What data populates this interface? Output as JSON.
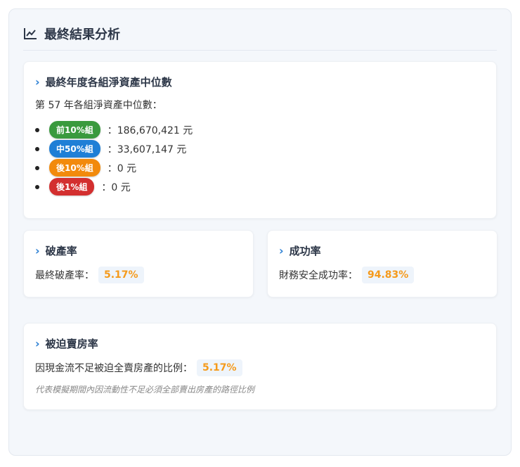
{
  "title": "最終結果分析",
  "median": {
    "heading": "最終年度各組淨資產中位數",
    "intro": "第 57 年各組淨資產中位數：",
    "groups": [
      {
        "label": "前10%組",
        "value": "：186,670,421 元",
        "color": "#3a9a3e"
      },
      {
        "label": "中50%組",
        "value": "：33,607,147 元",
        "color": "#1f7fd6"
      },
      {
        "label": "後10%組",
        "value": "：0 元",
        "color": "#f28a0c"
      },
      {
        "label": "後1%組",
        "value": "：0 元",
        "color": "#d32f2f"
      }
    ]
  },
  "bankruptcy": {
    "heading": "破產率",
    "label": "最終破產率：",
    "value": "5.17%"
  },
  "success": {
    "heading": "成功率",
    "label": "財務安全成功率：",
    "value": "94.83%"
  },
  "forced": {
    "heading": "被迫賣房率",
    "label": "因現金流不足被迫全賣房產的比例：",
    "value": "5.17%",
    "note": "代表模擬期間內因流動性不足必須全部賣出房產的路徑比例"
  }
}
